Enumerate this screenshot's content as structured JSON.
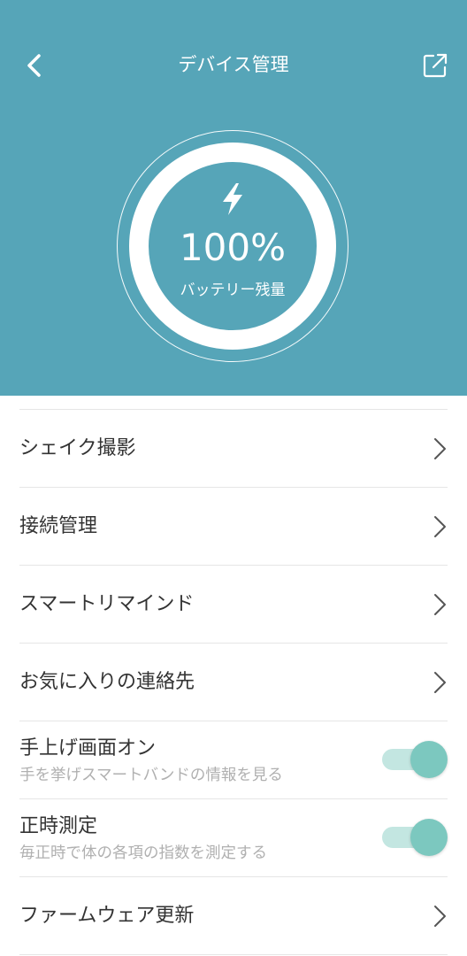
{
  "header": {
    "title": "デバイス管理",
    "back_icon": "chevron-left-icon",
    "share_icon": "external-link-icon",
    "background_color": "#56a5b8"
  },
  "battery": {
    "icon": "lightning-bolt-icon",
    "value": "100%",
    "label": "バッテリー残量",
    "level_percent": 100
  },
  "menu": {
    "shake_photo": "シェイク撮影",
    "connection": "接続管理",
    "smart_remind": "スマートリマインド",
    "favorite_contacts": "お気に入りの連絡先",
    "raise_to_wake": {
      "title": "手上げ画面オン",
      "description": "手を挙げスマートバンドの情報を見る",
      "enabled": true
    },
    "hourly_measure": {
      "title": "正時測定",
      "description": "毎正時で体の各項の指数を測定する",
      "enabled": true
    },
    "firmware_update": "ファームウェア更新"
  },
  "colors": {
    "toggle_on_knob": "#7cc8bf",
    "toggle_on_track": "#c3e6e1"
  }
}
